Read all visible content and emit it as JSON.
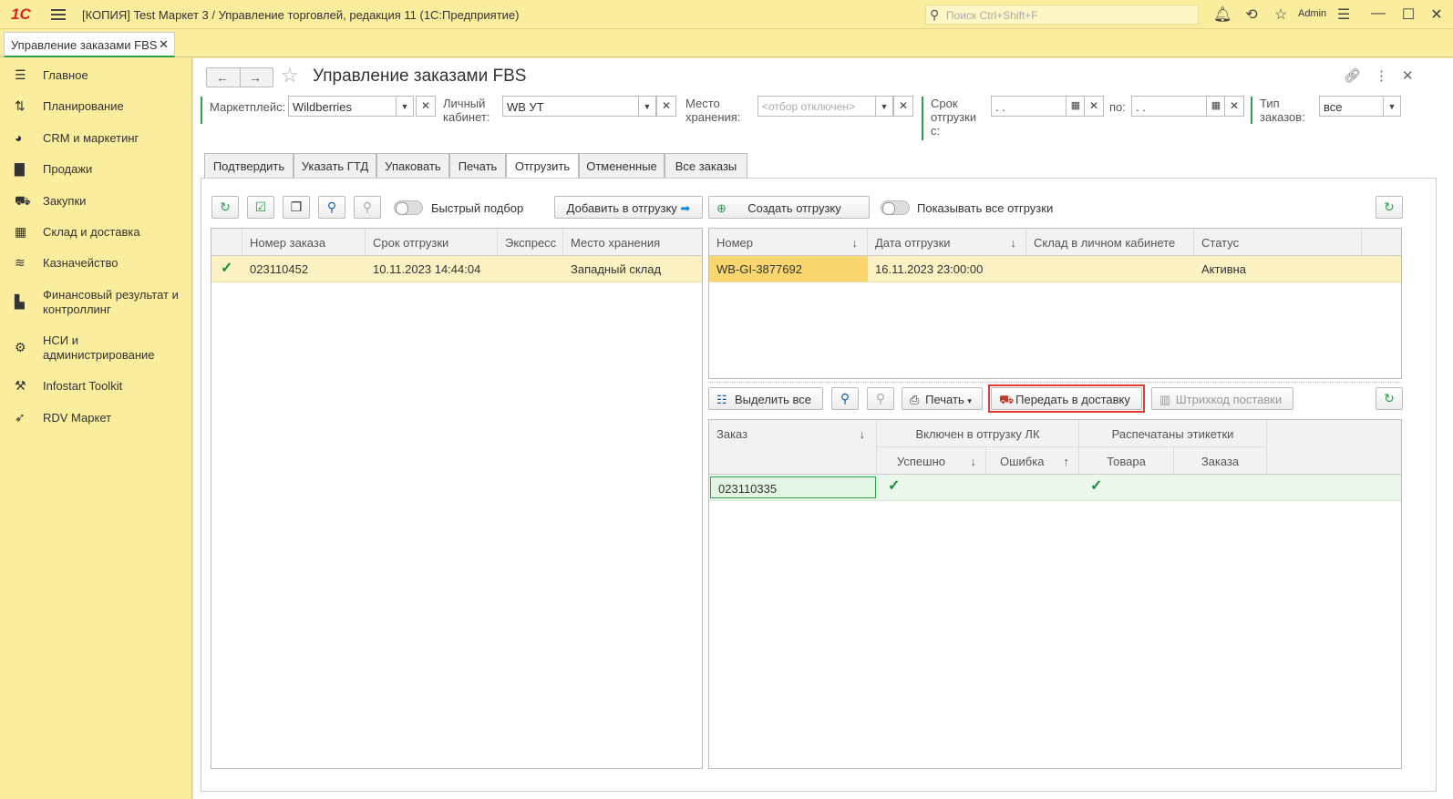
{
  "app": {
    "logo": "1С",
    "title": "[КОПИЯ] Test Маркет 3 / Управление торговлей, редакция 11  (1С:Предприятие)",
    "search_placeholder": "Поиск Ctrl+Shift+F",
    "user": "Admin",
    "window_tab": "Управление заказами FBS"
  },
  "sidebar": {
    "items": [
      {
        "label": "Главное",
        "icon": "menu-icon"
      },
      {
        "label": "Планирование",
        "icon": "planning-icon"
      },
      {
        "label": "CRM и маркетинг",
        "icon": "pie-chart-icon"
      },
      {
        "label": "Продажи",
        "icon": "bag-icon"
      },
      {
        "label": "Закупки",
        "icon": "cart-icon"
      },
      {
        "label": "Склад и доставка",
        "icon": "warehouse-icon"
      },
      {
        "label": "Казначейство",
        "icon": "coins-icon"
      },
      {
        "label": "Финансовый результат и контроллинг",
        "icon": "bar-chart-icon"
      },
      {
        "label": "НСИ и администрирование",
        "icon": "gear-icon"
      },
      {
        "label": "Infostart Toolkit",
        "icon": "tools-icon"
      },
      {
        "label": "RDV Маркет",
        "icon": "rocket-icon"
      }
    ]
  },
  "form": {
    "title": "Управление заказами FBS",
    "filters": {
      "marketplace_label": "Маркетплейс:",
      "marketplace_value": "Wildberries",
      "cabinet_label": "Личный кабинет:",
      "cabinet_value": "WB УТ",
      "storage_label": "Место хранения:",
      "storage_placeholder": "<отбор отключен>",
      "ship_from_label": "Срок отгрузки с:",
      "ship_from_value": " .  . ",
      "ship_to_label": "по:",
      "ship_to_value": " .  . ",
      "order_type_label": "Тип заказов:",
      "order_type_value": "все"
    },
    "tabs": [
      "Подтвердить",
      "Указать ГТД",
      "Упаковать",
      "Печать",
      "Отгрузить",
      "Отмененные",
      "Все заказы"
    ],
    "active_tab": "Отгрузить",
    "left": {
      "quick_select": "Быстрый подбор",
      "add_button": "Добавить в отгрузку",
      "columns": [
        "Номер заказа",
        "Срок отгрузки",
        "Экспресс",
        "Место хранения"
      ],
      "rows": [
        {
          "checked": true,
          "number": "023110452",
          "deadline": "10.11.2023 14:44:04",
          "express": "",
          "storage": "Западный склад"
        }
      ]
    },
    "right_top": {
      "create_button": "Создать отгрузку",
      "show_all": "Показывать все отгрузки",
      "columns": [
        "Номер",
        "Дата отгрузки",
        "Склад в личном кабинете",
        "Статус"
      ],
      "rows": [
        {
          "number": "WB-GI-3877692",
          "date": "16.11.2023 23:00:00",
          "warehouse": "",
          "status": "Активна"
        }
      ]
    },
    "right_bottom": {
      "select_all": "Выделить все",
      "print": "Печать",
      "deliver": "Передать в доставку",
      "barcode": "Штрихкод поставки",
      "col_order": "Заказ",
      "col_included": "Включен в отгрузку ЛК",
      "col_success": "Успешно",
      "col_error": "Ошибка",
      "col_labels": "Распечатаны этикетки",
      "col_goods": "Товара",
      "col_order_label": "Заказа",
      "rows": [
        {
          "order": "023110335",
          "success": true,
          "error": false,
          "goods": true,
          "order_printed": false
        }
      ]
    }
  },
  "colors": {
    "accent_yellow": "#fbed9e",
    "green": "#2e9e4b",
    "highlight_red": "#e53935"
  }
}
